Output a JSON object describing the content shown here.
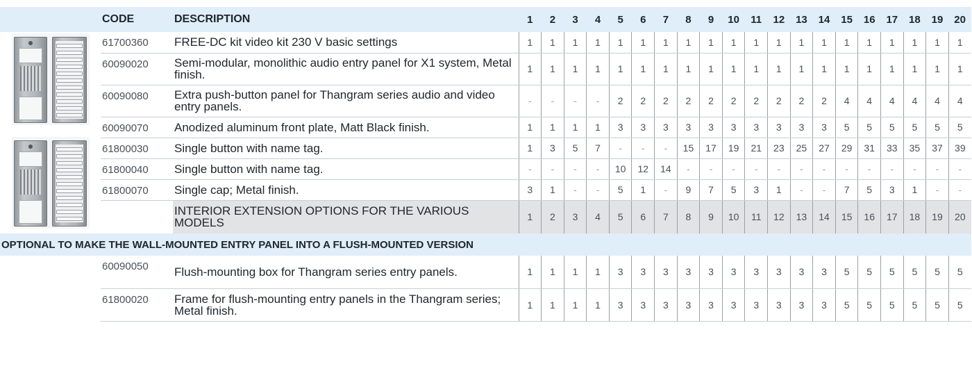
{
  "headers": {
    "code": "CODE",
    "description": "DESCRIPTION",
    "columns": [
      "1",
      "2",
      "3",
      "4",
      "5",
      "6",
      "7",
      "8",
      "9",
      "10",
      "11",
      "12",
      "13",
      "14",
      "15",
      "16",
      "17",
      "18",
      "19",
      "20"
    ]
  },
  "rows": [
    {
      "code": "61700360",
      "description": "FREE-DC kit video kit 230 V basic settings",
      "values": [
        "1",
        "1",
        "1",
        "1",
        "1",
        "1",
        "1",
        "1",
        "1",
        "1",
        "1",
        "1",
        "1",
        "1",
        "1",
        "1",
        "1",
        "1",
        "1",
        "1"
      ]
    },
    {
      "code": "60090020",
      "description": "Semi-modular, monolithic audio entry panel for X1 system, Metal finish.",
      "values": [
        "1",
        "1",
        "1",
        "1",
        "1",
        "1",
        "1",
        "1",
        "1",
        "1",
        "1",
        "1",
        "1",
        "1",
        "1",
        "1",
        "1",
        "1",
        "1",
        "1"
      ]
    },
    {
      "code": "60090080",
      "description": "Extra push-button panel for Thangram series audio and video entry panels.",
      "values": [
        "-",
        "-",
        "-",
        "-",
        "2",
        "2",
        "2",
        "2",
        "2",
        "2",
        "2",
        "2",
        "2",
        "2",
        "4",
        "4",
        "4",
        "4",
        "4",
        "4"
      ]
    },
    {
      "code": "60090070",
      "description": "Anodized aluminum front plate, Matt Black finish.",
      "values": [
        "1",
        "1",
        "1",
        "1",
        "3",
        "3",
        "3",
        "3",
        "3",
        "3",
        "3",
        "3",
        "3",
        "3",
        "5",
        "5",
        "5",
        "5",
        "5",
        "5"
      ]
    },
    {
      "code": "61800030",
      "description": "Single button with name tag.",
      "values": [
        "1",
        "3",
        "5",
        "7",
        "-",
        "-",
        "-",
        "15",
        "17",
        "19",
        "21",
        "23",
        "25",
        "27",
        "29",
        "31",
        "33",
        "35",
        "37",
        "39"
      ]
    },
    {
      "code": "61800040",
      "description": "Single button with name tag.",
      "values": [
        "-",
        "-",
        "-",
        "-",
        "10",
        "12",
        "14",
        "-",
        "-",
        "-",
        "-",
        "-",
        "-",
        "-",
        "-",
        "-",
        "-",
        "-",
        "-",
        "-"
      ]
    },
    {
      "code": "61800070",
      "description": "Single cap; Metal finish.",
      "values": [
        "3",
        "1",
        "-",
        "-",
        "5",
        "1",
        "-",
        "9",
        "7",
        "5",
        "3",
        "1",
        "-",
        "-",
        "7",
        "5",
        "3",
        "1",
        "-",
        "-"
      ]
    }
  ],
  "extension": {
    "description": "INTERIOR EXTENSION OPTIONS FOR THE VARIOUS MODELS",
    "values": [
      "1",
      "2",
      "3",
      "4",
      "5",
      "6",
      "7",
      "8",
      "9",
      "10",
      "11",
      "12",
      "13",
      "14",
      "15",
      "16",
      "17",
      "18",
      "19",
      "20"
    ]
  },
  "optional_section": {
    "title": "OPTIONAL TO MAKE THE WALL-MOUNTED ENTRY PANEL INTO A FLUSH-MOUNTED VERSION"
  },
  "optional_rows": [
    {
      "code": "60090050",
      "description": "Flush-mounting box for Thangram series entry panels.",
      "values": [
        "1",
        "1",
        "1",
        "1",
        "3",
        "3",
        "3",
        "3",
        "3",
        "3",
        "3",
        "3",
        "3",
        "3",
        "5",
        "5",
        "5",
        "5",
        "5",
        "5"
      ]
    },
    {
      "code": "61800020",
      "description": "Frame for flush-mounting entry panels in the Thangram series; Metal finish.",
      "values": [
        "1",
        "1",
        "1",
        "1",
        "3",
        "3",
        "3",
        "3",
        "3",
        "3",
        "3",
        "3",
        "3",
        "3",
        "5",
        "5",
        "5",
        "5",
        "5",
        "5"
      ]
    }
  ]
}
